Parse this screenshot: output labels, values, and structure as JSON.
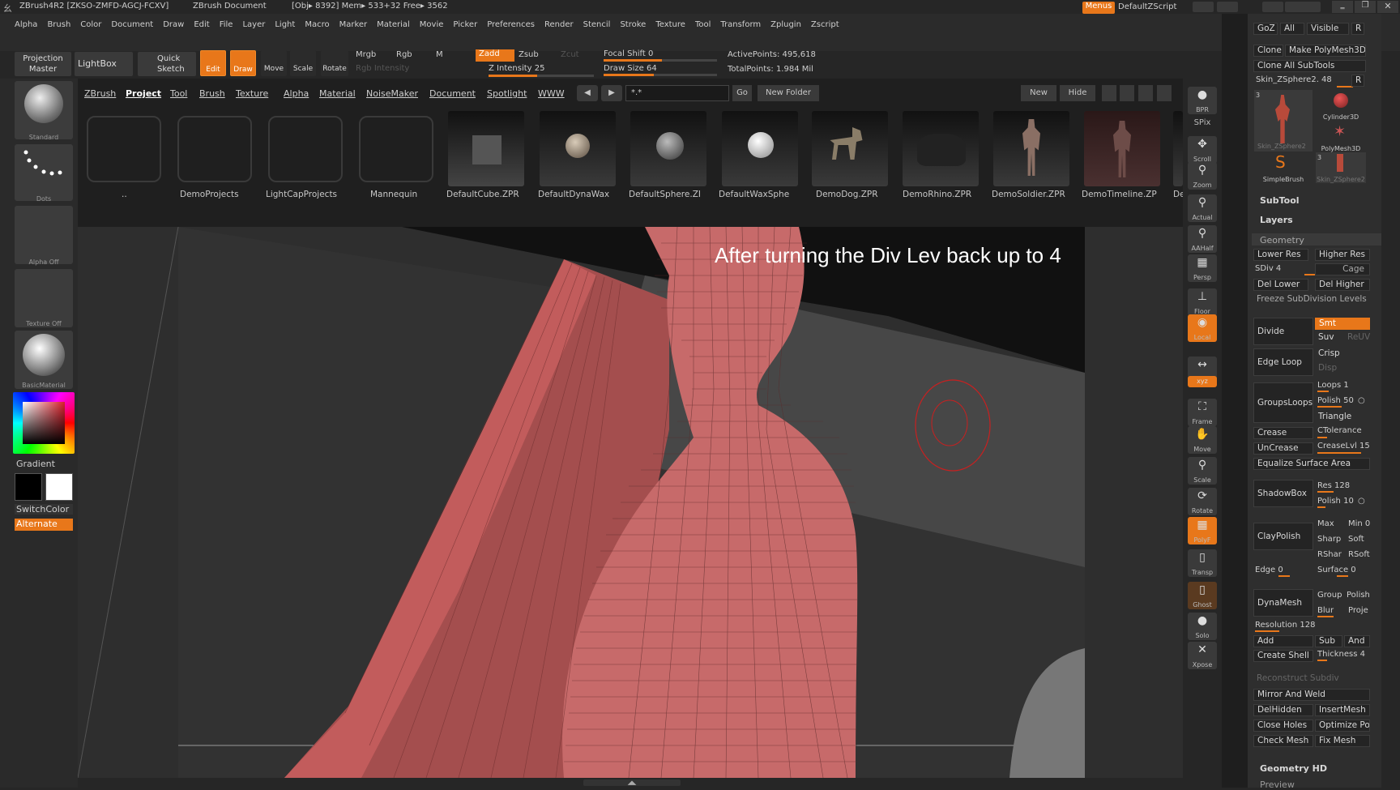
{
  "titlebar": {
    "app": "ZBrush4R2 [ZKSO-ZMFD-AGCJ-FCXV]",
    "doc": "ZBrush Document",
    "stats": "[Obj▸ 8392] Mem▸ 533+32 Free▸ 3562",
    "menus_btn": "Menus",
    "script": "DefaultZScript"
  },
  "menu": [
    "Alpha",
    "Brush",
    "Color",
    "Document",
    "Draw",
    "Edit",
    "File",
    "Layer",
    "Light",
    "Macro",
    "Marker",
    "Material",
    "Movie",
    "Picker",
    "Preferences",
    "Render",
    "Stencil",
    "Stroke",
    "Texture",
    "Tool",
    "Transform",
    "Zplugin",
    "Zscript"
  ],
  "toolbar": {
    "projection_master": "Projection Master",
    "lightbox": "LightBox",
    "quick_sketch": "Quick Sketch",
    "edit": "Edit",
    "draw": "Draw",
    "move": "Move",
    "scale": "Scale",
    "rotate": "Rotate",
    "mrgb": "Mrgb",
    "rgb": "Rgb",
    "m": "M",
    "rgb_intensity": "Rgb Intensity",
    "zadd": "Zadd",
    "zsub": "Zsub",
    "zcut": "Zcut",
    "z_intensity": "Z Intensity 25",
    "focal_shift": "Focal Shift 0",
    "draw_size": "Draw Size 64",
    "active_points": "ActivePoints: 495,618",
    "total_points": "TotalPoints: 1.984 Mil"
  },
  "leftbar": {
    "standard": "Standard",
    "dots": "Dots",
    "alpha_off": "Alpha Off",
    "texture_off": "Texture Off",
    "basic_material": "BasicMaterial",
    "gradient": "Gradient",
    "switch_color": "SwitchColor",
    "alternate": "Alternate"
  },
  "lightbox": {
    "tabs": [
      "ZBrush",
      "Project",
      "Tool",
      "Brush",
      "Texture",
      "Alpha",
      "Material",
      "NoiseMaker",
      "Document",
      "Spotlight",
      "WWW"
    ],
    "search": "*.*",
    "go": "Go",
    "new_folder": "New Folder",
    "new": "New",
    "hide": "Hide",
    "items": [
      "..",
      "DemoProjects",
      "LightCapProjects",
      "Mannequin",
      "DefaultCube.ZPR",
      "DefaultDynaWax",
      "DefaultSphere.ZI",
      "DefaultWaxSphe",
      "DemoDog.ZPR",
      "DemoRhino.ZPR",
      "DemoSoldier.ZPR",
      "DemoTimeline.ZP",
      "De"
    ]
  },
  "viewport": {
    "caption": "After turning the Div Lev back up to 4"
  },
  "rightstrip": [
    "BPR",
    "SPix",
    "Scroll",
    "Zoom",
    "Actual",
    "AAHalf",
    "Persp",
    "Floor",
    "Local",
    "L.Sym",
    "Xyz",
    "Frame",
    "Move",
    "Scale",
    "Rotate",
    "PolyF",
    "Transp",
    "Ghost",
    "Solo",
    "Xpose"
  ],
  "tool": {
    "goz": "GoZ",
    "all": "All",
    "visible": "Visible",
    "r": "R",
    "clone": "Clone",
    "make_polymesh": "Make PolyMesh3D",
    "clone_all": "Clone All SubTools",
    "current": "Skin_ZSphere2. 48",
    "thumbs": [
      "Skin_ZSphere2",
      "Cylinder3D",
      "PolyMesh3D",
      "SimpleBrush",
      "Skin_ZSphere2"
    ],
    "subtool": "SubTool",
    "layers": "Layers",
    "geometry": "Geometry",
    "geometry_hd": "Geometry HD",
    "preview": "Preview"
  },
  "geometry": {
    "lower_res": "Lower Res",
    "higher_res": "Higher Res",
    "sdiv": "SDiv 4",
    "cage": "Cage",
    "del_lower": "Del Lower",
    "del_higher": "Del Higher",
    "freeze": "Freeze SubDivision Levels",
    "divide": "Divide",
    "smt": "Smt",
    "suv": "Suv",
    "reuv": "ReUV",
    "edge_loop": "Edge Loop",
    "crisp": "Crisp",
    "disp": "Disp",
    "groups_loops": "GroupsLoops",
    "loops": "Loops 1",
    "polish": "Polish 50",
    "triangle": "Triangle",
    "crease": "Crease",
    "ctolerance": "CTolerance",
    "uncrease": "UnCrease",
    "creaselvl": "CreaseLvl 15",
    "equalize": "Equalize Surface Area",
    "shadowbox": "ShadowBox",
    "res": "Res 128",
    "sb_polish": "Polish 10",
    "claypolish": "ClayPolish",
    "max": "Max",
    "min": "Min 0",
    "sharp": "Sharp",
    "soft": "Soft",
    "rshar": "RShar",
    "rsoft": "RSoft",
    "edge": "Edge 0",
    "surface": "Surface 0",
    "dynamesh": "DynaMesh",
    "group": "Group",
    "dm_polish": "Polish",
    "blur": "Blur",
    "project": "Proje",
    "resolution": "Resolution 128",
    "add": "Add",
    "sub": "Sub",
    "and": "And",
    "create_shell": "Create Shell",
    "thickness": "Thickness 4",
    "reconstruct": "Reconstruct Subdiv",
    "mirror_weld": "Mirror And Weld",
    "delhidden": "DelHidden",
    "insertmesh": "InsertMesh",
    "close_holes": "Close Holes",
    "optimize": "Optimize Po",
    "check_mesh": "Check Mesh",
    "fix_mesh": "Fix Mesh"
  },
  "colors": {
    "accent": "#e8771a",
    "skin": "#c46a6a",
    "background": "#2b2b2b"
  }
}
